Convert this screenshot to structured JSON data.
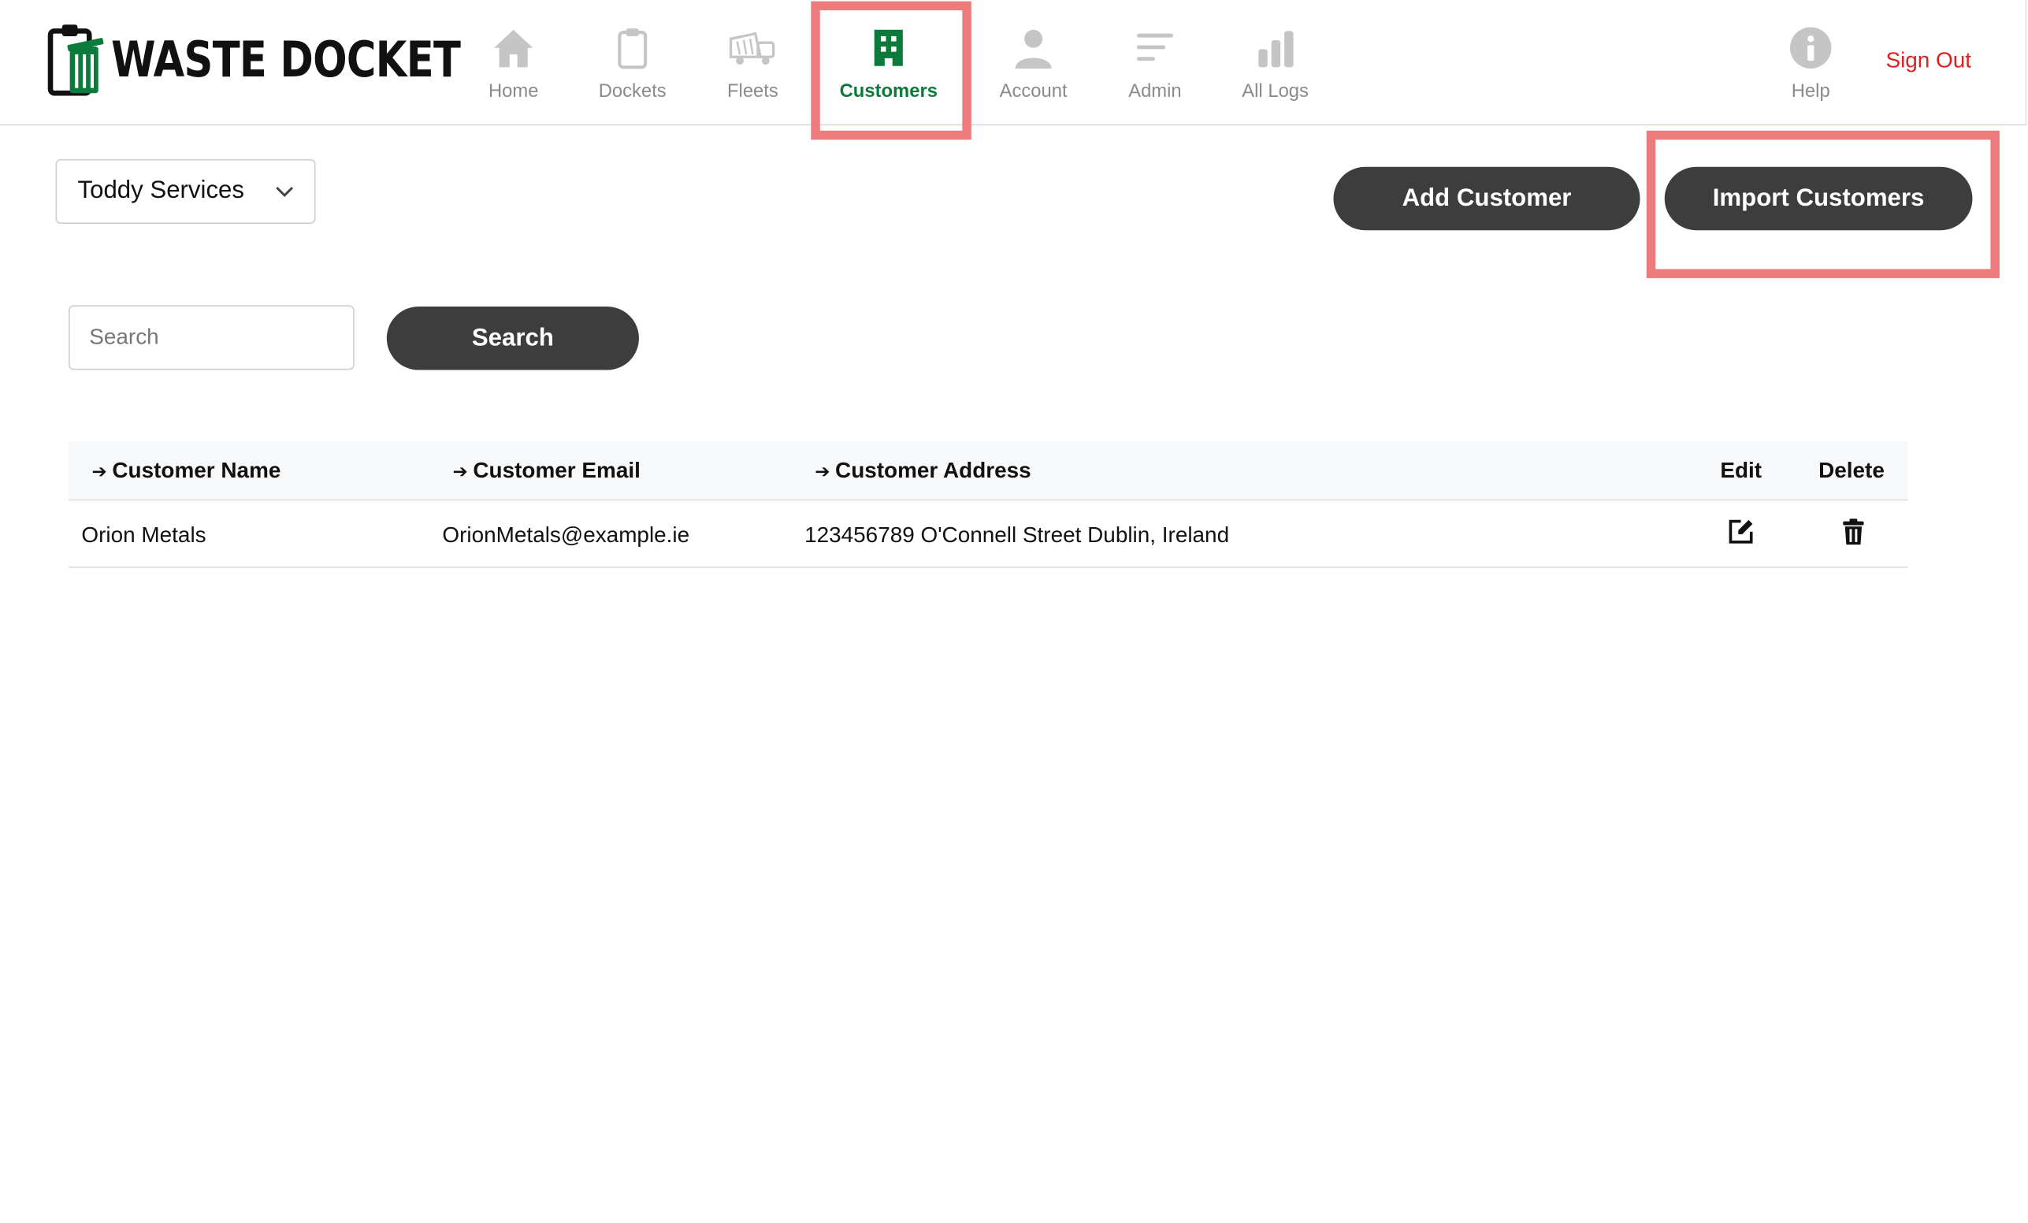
{
  "header": {
    "logo_text": "WASTE DOCKET",
    "nav": [
      {
        "label": "Home",
        "icon": "home-icon",
        "active": false
      },
      {
        "label": "Dockets",
        "icon": "clipboard-icon",
        "active": false
      },
      {
        "label": "Fleets",
        "icon": "truck-icon",
        "active": false
      },
      {
        "label": "Customers",
        "icon": "building-icon",
        "active": true
      },
      {
        "label": "Account",
        "icon": "user-icon",
        "active": false
      },
      {
        "label": "Admin",
        "icon": "list-icon",
        "active": false
      },
      {
        "label": "All Logs",
        "icon": "bar-chart-icon",
        "active": false
      }
    ],
    "help_label": "Help",
    "sign_out": "Sign Out"
  },
  "toolbar": {
    "company_select": "Toddy Services",
    "add_customer": "Add Customer",
    "import_customers": "Import Customers"
  },
  "search": {
    "placeholder": "Search",
    "value": "",
    "button": "Search"
  },
  "table": {
    "columns": {
      "name": "Customer Name",
      "email": "Customer Email",
      "address": "Customer Address",
      "edit": "Edit",
      "delete": "Delete"
    },
    "rows": [
      {
        "name": "Orion Metals",
        "email": "OrionMetals@example.ie",
        "address": "123456789 O'Connell Street Dublin, Ireland"
      }
    ]
  },
  "colors": {
    "accent_green": "#0b7a3a",
    "button_dark": "#3d3d3d",
    "sign_out_red": "#e02020",
    "highlight": "#ec7b7b"
  }
}
